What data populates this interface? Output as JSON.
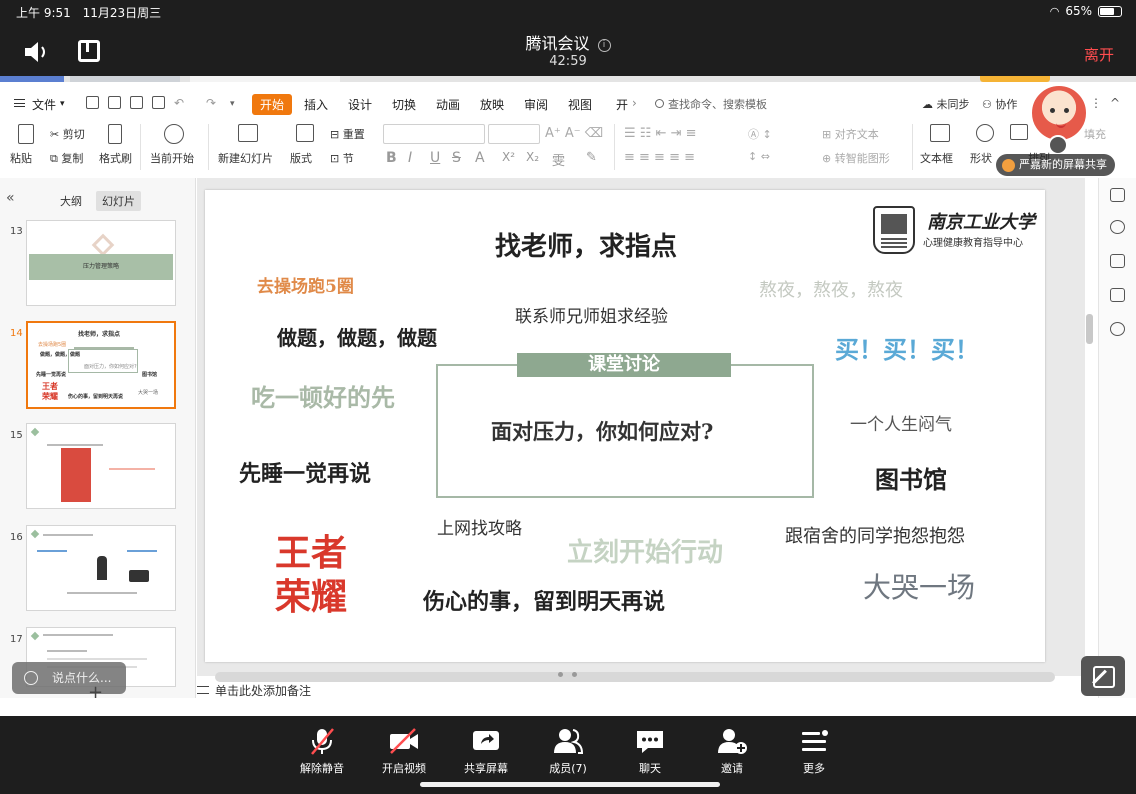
{
  "status_bar": {
    "time": "上午 9:51",
    "date": "11月23日周三",
    "battery": "65%"
  },
  "meeting": {
    "title": "腾讯会议",
    "timer": "42:59",
    "leave": "离开",
    "screen_share_label": "严嘉新的屏幕共享"
  },
  "wps": {
    "menu": {
      "file": "文件",
      "tabs": [
        "开始",
        "插入",
        "设计",
        "切换",
        "动画",
        "放映",
        "审阅",
        "视图",
        "开"
      ],
      "search_placeholder": "查找命令、搜索模板",
      "sync": "未同步",
      "collab": "协作"
    },
    "ribbon": {
      "paste": "粘贴",
      "cut": "剪切",
      "copy": "复制",
      "format_painter": "格式刷",
      "play_from_current": "当前开始",
      "new_slide": "新建幻灯片",
      "layout": "版式",
      "reset": "重置",
      "section": "节",
      "align_text": "对齐文本",
      "smart_shape": "转智能图形",
      "textbox": "文本框",
      "shape": "形状",
      "arrange": "排列",
      "fill": "填充"
    },
    "left_pane": {
      "tab_outline": "大纲",
      "tab_slides": "幻灯片",
      "slides": [
        {
          "num": "13",
          "title": "压力管理策略"
        },
        {
          "num": "14"
        },
        {
          "num": "15"
        },
        {
          "num": "16"
        },
        {
          "num": "17"
        }
      ]
    },
    "notes_placeholder": "单击此处添加备注",
    "chat_placeholder": "说点什么..."
  },
  "slide": {
    "title": "找老师，求指点",
    "center_tag": "课堂讨论",
    "center_question": "面对压力，你如何应对?",
    "university": "南京工业大学",
    "center_name": "心理健康教育指导中心",
    "words": {
      "run": "去操场跑5圈",
      "stay_up": "熬夜，熬夜，熬夜",
      "seniors": "联系师兄师姐求经验",
      "exercises": "做题，做题，做题",
      "shopping": "买！买！买！",
      "eat": "吃一顿好的先",
      "sulk": "一个人生闷气",
      "sleep": "先睡一觉再说",
      "library": "图书馆",
      "online": "上网找攻略",
      "act_now": "立刻开始行动",
      "complain": "跟宿舍的同学抱怨抱怨",
      "game_1": "王者",
      "game_2": "荣耀",
      "tomorrow": "伤心的事，留到明天再说",
      "cry": "大哭一场"
    },
    "colors": {
      "orange": "#e08a49",
      "grey_green": "#a9b9a7",
      "red": "#d9382b",
      "blue": "#5aa9d6",
      "dark": "#222222",
      "slate": "#6f7780"
    }
  },
  "toolbar": {
    "mute": "解除静音",
    "video": "开启视频",
    "share": "共享屏幕",
    "members": "成员(7)",
    "chat": "聊天",
    "invite": "邀请",
    "more": "更多"
  }
}
